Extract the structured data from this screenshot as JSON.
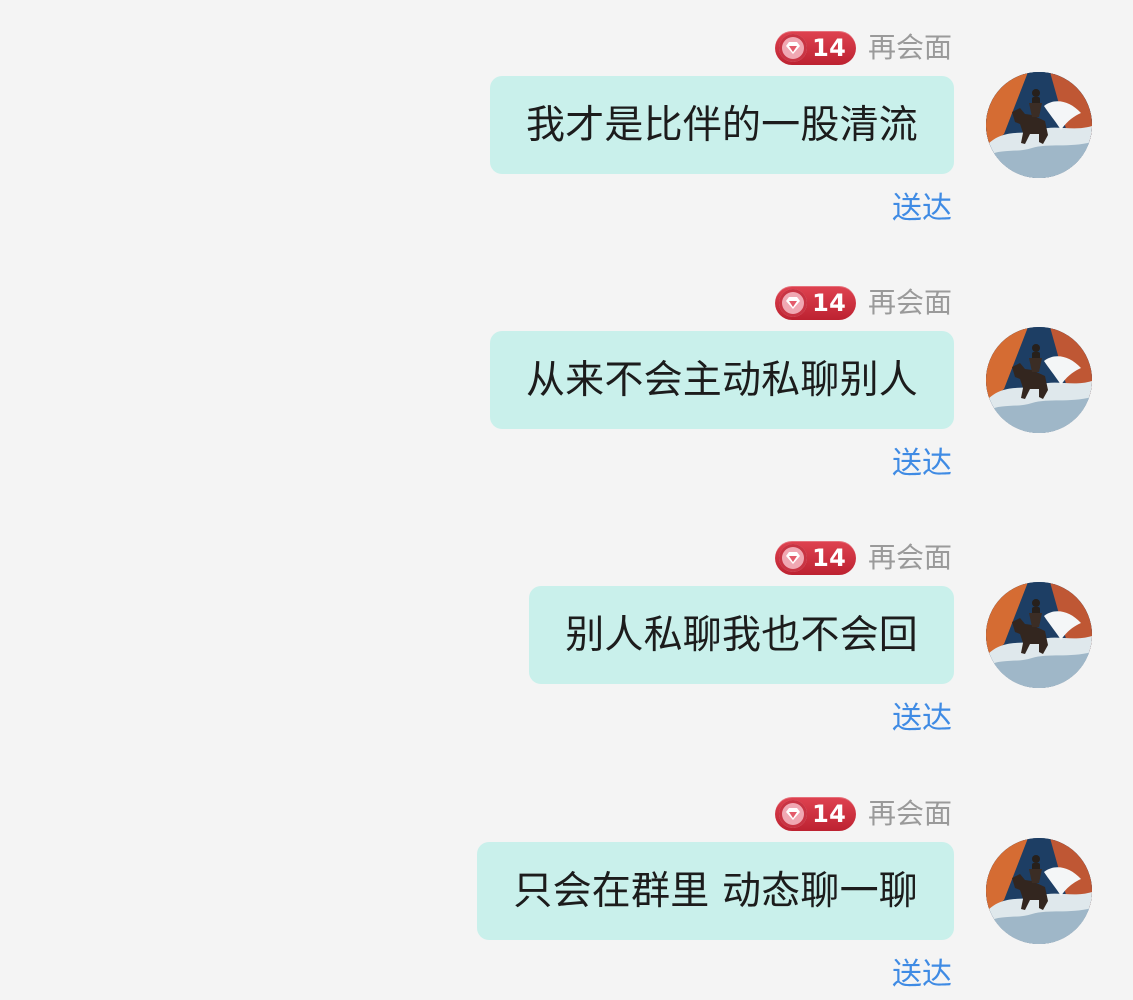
{
  "messages": [
    {
      "sender_name": "再会面",
      "level_badge": "14",
      "text": "我才是比伴的一股清流",
      "status": "送达",
      "avatar_icon": "horse-rider-icon"
    },
    {
      "sender_name": "再会面",
      "level_badge": "14",
      "text": "从来不会主动私聊别人",
      "status": "送达",
      "avatar_icon": "horse-rider-icon"
    },
    {
      "sender_name": "再会面",
      "level_badge": "14",
      "text": "别人私聊我也不会回",
      "status": "送达",
      "avatar_icon": "horse-rider-icon"
    },
    {
      "sender_name": "再会面",
      "level_badge": "14",
      "text": "只会在群里 动态聊一聊",
      "status": "送达",
      "avatar_icon": "horse-rider-icon"
    }
  ],
  "colors": {
    "background": "#f4f4f4",
    "bubble": "#c9f0eb",
    "badge": "#cf2f3e",
    "status_blue": "#3f8be4",
    "name_gray": "#9a9a9a"
  }
}
